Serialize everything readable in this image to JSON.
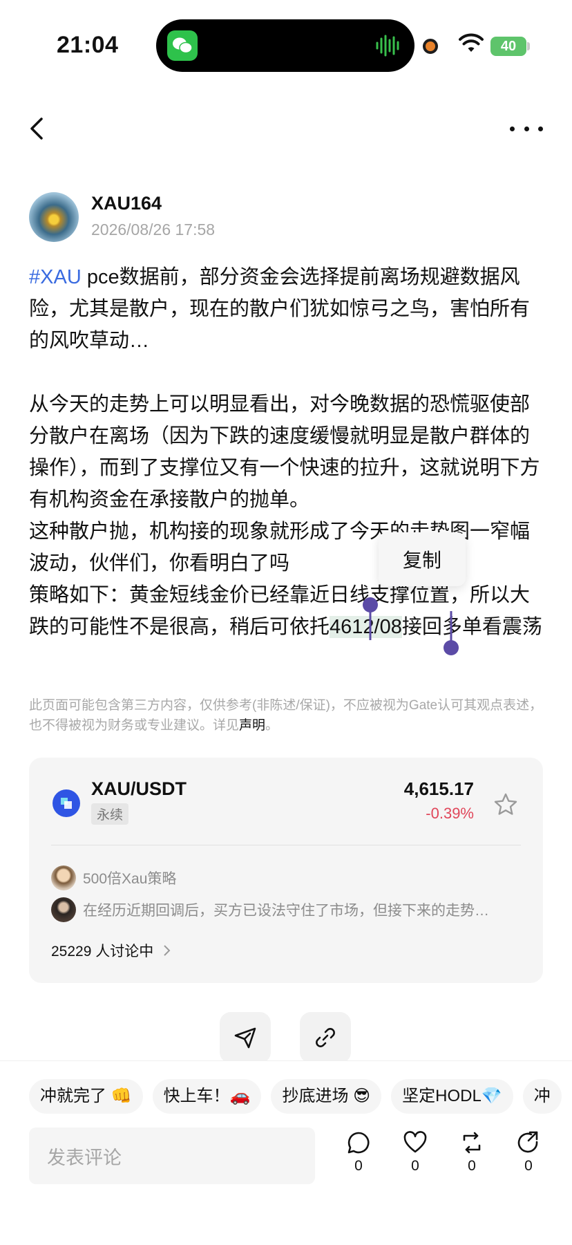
{
  "status": {
    "time": "21:04",
    "battery": "40"
  },
  "author": {
    "name": "XAU164",
    "time": "2026/08/26 17:58"
  },
  "post": {
    "hashtag": "#XAU",
    "line1_rest": " pce数据前，部分资金会选择提前离场规避数据风险，尤其是散户，现在的散户们犹如惊弓之鸟，害怕所有的风吹草动…",
    "para2": "从今天的走势上可以明显看出，对今晚数据的恐慌驱使部分散户在离场（因为下跌的速度缓慢就明显是散户群体的操作），而到了支撑位又有一个快速的拉升，这就说明下方有机构资金在承接散户的抛单。",
    "para3": "这种散户抛，机构接的现象就形成了今天的走势图一窄幅波动，伙伴们，你看明白了吗",
    "para4_pre": "策略如下：黄金短线金价已经靠近日线支撑位置，所以大跌的可能性不是很高，稍后可依托",
    "para4_sel": "4612/08",
    "para4_post": "接回多单看震荡"
  },
  "popup": {
    "copy_label": "复制"
  },
  "disclaimer": {
    "text": "此页面可能包含第三方内容，仅供参考(非陈述/保证)，不应被视为Gate认可其观点表述，也不得被视为财务或专业建议。详见",
    "link": "声明",
    "end": "。"
  },
  "market": {
    "pair": "XAU/USDT",
    "tag": "永续",
    "price": "4,615.17",
    "change": "-0.39%",
    "change_color": "#e0465a",
    "discussions": [
      {
        "text": "500倍Xau策略"
      },
      {
        "text": "在经历近期回调后，买方已设法守住了市场，但接下来的走势…"
      }
    ],
    "count": "25229 人讨论中"
  },
  "chips": [
    "冲就完了 👊",
    "快上车！🚗",
    "抄底进场 😎",
    "坚定HODL💎",
    "冲"
  ],
  "comment": {
    "placeholder": "发表评论"
  },
  "actions": {
    "comments": "0",
    "likes": "0",
    "reposts": "0",
    "shares": "0"
  },
  "accent_color": "#3a6be0"
}
